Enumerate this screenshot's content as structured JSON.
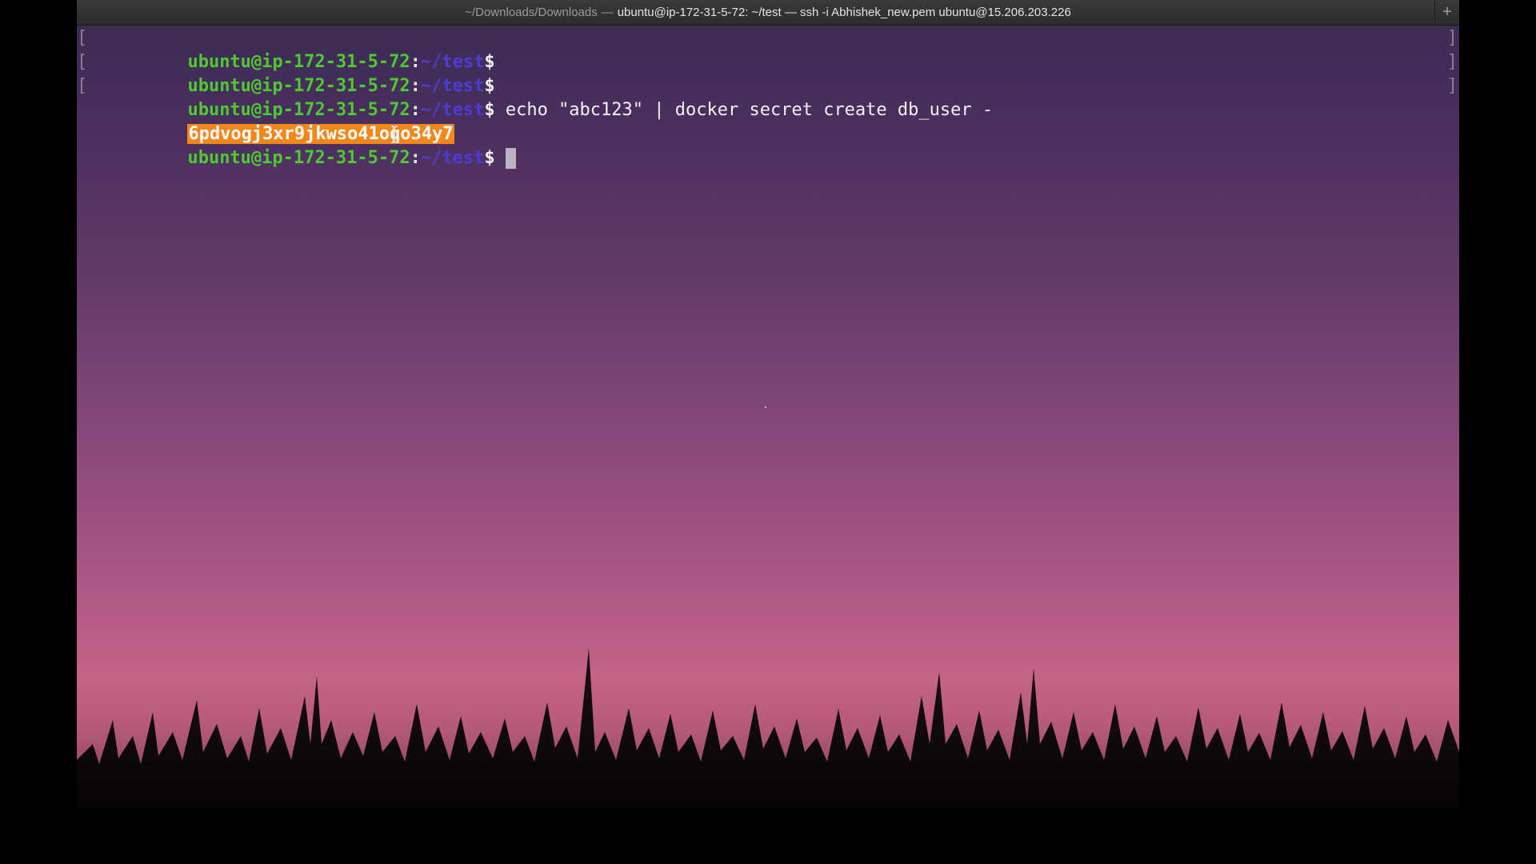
{
  "window": {
    "title_dim": "~/Downloads/Downloads",
    "title_separator": "—",
    "title_main": "ubuntu@ip-172-31-5-72: ~/test — ssh -i Abhishek_new.pem ubuntu@15.206.203.226",
    "new_tab_icon": "plus-icon",
    "new_tab_glyph": "+"
  },
  "terminal": {
    "colors": {
      "user": "#4fc832",
      "path": "#4b3cd6",
      "highlight": "#f3871c"
    },
    "lines": [
      {
        "user": "ubuntu@ip-172-31-5-72",
        "colon": ":",
        "path": "~/test",
        "dollar": "$",
        "command": ""
      },
      {
        "user": "ubuntu@ip-172-31-5-72",
        "colon": ":",
        "path": "~/test",
        "dollar": "$",
        "command": ""
      },
      {
        "user": "ubuntu@ip-172-31-5-72",
        "colon": ":",
        "path": "~/test",
        "dollar": "$",
        "command": " echo \"abc123\" | docker secret create db_user -"
      },
      {
        "output": "6pdvogj3xr9jkwso41oqo34y7"
      },
      {
        "user": "ubuntu@ip-172-31-5-72",
        "colon": ":",
        "path": "~/test",
        "dollar": "$",
        "command": " "
      }
    ],
    "mark_left": "[",
    "mark_right": "]"
  }
}
